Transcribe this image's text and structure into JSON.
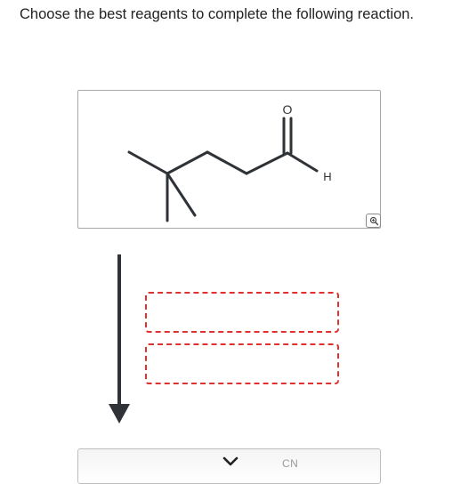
{
  "question": {
    "text": "Choose the best reagents to complete the following reaction."
  },
  "structure": {
    "atom_labels": {
      "oxygen": "O",
      "hydrogen": "H"
    }
  },
  "toolbar": {
    "zoom_icon": "magnifier-icon"
  },
  "reagent_slots": [
    {
      "filled": false,
      "value": ""
    },
    {
      "filled": false,
      "value": ""
    }
  ],
  "reagent_picker": {
    "visible_label": "CN",
    "chevron_icon": "chevron-down-icon"
  },
  "colors": {
    "bond": "#2f3337",
    "slot_border": "#e0312f",
    "arrow": "#2f3337"
  }
}
